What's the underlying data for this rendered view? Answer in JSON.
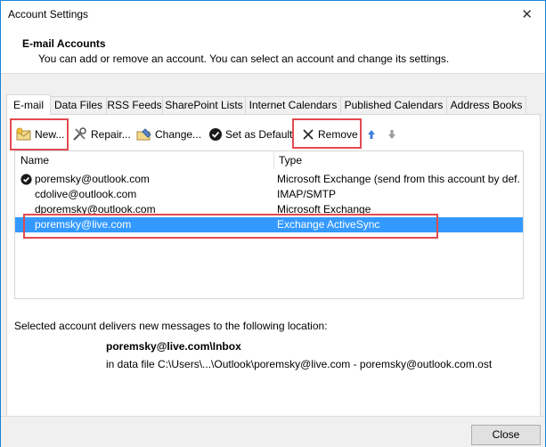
{
  "window": {
    "title": "Account Settings",
    "close_glyph": "✕"
  },
  "header": {
    "title": "E-mail Accounts",
    "subtitle": "You can add or remove an account. You can select an account and change its settings."
  },
  "tabs": [
    {
      "label": "E-mail"
    },
    {
      "label": "Data Files"
    },
    {
      "label": "RSS Feeds"
    },
    {
      "label": "SharePoint Lists"
    },
    {
      "label": "Internet Calendars"
    },
    {
      "label": "Published Calendars"
    },
    {
      "label": "Address Books"
    }
  ],
  "toolbar": {
    "new_label": "New...",
    "repair_label": "Repair...",
    "change_label": "Change...",
    "default_label": "Set as Default",
    "remove_label": "Remove"
  },
  "list": {
    "col_name": "Name",
    "col_type": "Type",
    "rows": [
      {
        "name": "poremsky@outlook.com",
        "type": "Microsoft Exchange (send from this account by def..."
      },
      {
        "name": "cdolive@outlook.com",
        "type": "IMAP/SMTP"
      },
      {
        "name": "dporemsky@outlook.com",
        "type": "Microsoft Exchange"
      },
      {
        "name": "poremsky@live.com",
        "type": "Exchange ActiveSync"
      }
    ]
  },
  "delivery": {
    "intro": "Selected account delivers new messages to the following location:",
    "location": "poremsky@live.com\\Inbox",
    "datafile": "in data file C:\\Users\\...\\Outlook\\poremsky@live.com - poremsky@outlook.com.ost"
  },
  "footer": {
    "close_label": "Close"
  },
  "colors": {
    "selection": "#3399ff",
    "highlight_box": "#e24a4f",
    "window_border": "#1883d7"
  }
}
